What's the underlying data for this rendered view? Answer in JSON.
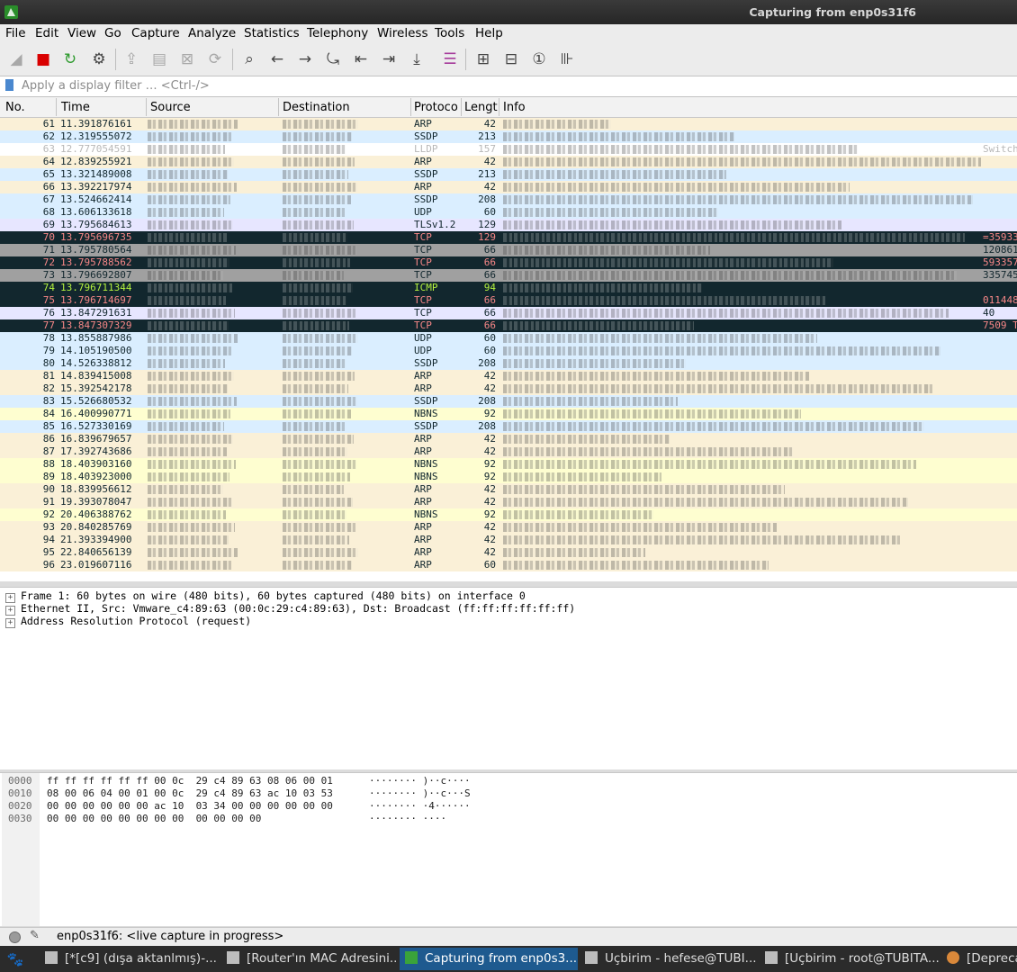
{
  "window": {
    "title": "Capturing from enp0s31f6"
  },
  "menu": [
    "File",
    "Edit",
    "View",
    "Go",
    "Capture",
    "Analyze",
    "Statistics",
    "Telephony",
    "Wireless",
    "Tools",
    "Help"
  ],
  "toolbar": {
    "buttons": [
      {
        "name": "shark-fin-start-icon",
        "glyph": "◢",
        "dim": true
      },
      {
        "name": "stop-capture-icon",
        "glyph": "■",
        "color": "#d90000"
      },
      {
        "name": "restart-capture-icon",
        "glyph": "↻",
        "color": "#2f9b2f"
      },
      {
        "name": "capture-options-icon",
        "glyph": "⚙"
      },
      {
        "name": "open-file-icon",
        "glyph": "⇪",
        "dim": true
      },
      {
        "name": "save-file-icon",
        "glyph": "▤",
        "dim": true
      },
      {
        "name": "close-file-icon",
        "glyph": "⊠",
        "dim": true
      },
      {
        "name": "reload-file-icon",
        "glyph": "⟳",
        "dim": true
      },
      {
        "name": "find-packet-icon",
        "glyph": "⌕"
      },
      {
        "name": "go-back-icon",
        "glyph": "←"
      },
      {
        "name": "go-forward-icon",
        "glyph": "→"
      },
      {
        "name": "go-to-packet-icon",
        "glyph": "⤿"
      },
      {
        "name": "first-packet-icon",
        "glyph": "⇤"
      },
      {
        "name": "last-packet-icon",
        "glyph": "⇥"
      },
      {
        "name": "autoscroll-icon",
        "glyph": "⤓"
      },
      {
        "name": "colorize-icon",
        "glyph": "☰",
        "color": "#a63c9b"
      },
      {
        "name": "zoom-in-icon",
        "glyph": "⊞"
      },
      {
        "name": "zoom-out-icon",
        "glyph": "⊟"
      },
      {
        "name": "normal-size-icon",
        "glyph": "①"
      },
      {
        "name": "resize-columns-icon",
        "glyph": "⊪"
      }
    ]
  },
  "filter": {
    "placeholder": "Apply a display filter … <Ctrl-/>"
  },
  "columns": [
    "No.",
    "Time",
    "Source",
    "Destination",
    "Protocol",
    "Length",
    "Info"
  ],
  "columns_display": [
    "No.",
    "Time",
    "Source",
    "Destination",
    "Protoco",
    "Lengt",
    "Info"
  ],
  "colors": {
    "arp": "#faf0d7",
    "udp": "#daeeff",
    "lldp": "#ffffff",
    "tls": "#e7e6ff",
    "tcp_bad": "#12272e",
    "tcp_bad_text": "#f78787",
    "tcp_grey": "#a0a0a0",
    "icmp_bad_text": "#b5f23e",
    "nbns": "#fefed0"
  },
  "packets": [
    {
      "no": "61",
      "time": "11.391876161",
      "proto": "ARP",
      "len": "42",
      "style": "arp"
    },
    {
      "no": "62",
      "time": "12.319555072",
      "proto": "SSDP",
      "len": "213",
      "style": "udp"
    },
    {
      "no": "63",
      "time": "12.777054591",
      "proto": "LLDP",
      "len": "157",
      "style": "lldp",
      "tail": "Switch"
    },
    {
      "no": "64",
      "time": "12.839255921",
      "proto": "ARP",
      "len": "42",
      "style": "arp"
    },
    {
      "no": "65",
      "time": "13.321489008",
      "proto": "SSDP",
      "len": "213",
      "style": "udp"
    },
    {
      "no": "66",
      "time": "13.392217974",
      "proto": "ARP",
      "len": "42",
      "style": "arp"
    },
    {
      "no": "67",
      "time": "13.524662414",
      "proto": "SSDP",
      "len": "208",
      "style": "udp"
    },
    {
      "no": "68",
      "time": "13.606133618",
      "proto": "UDP",
      "len": "60",
      "style": "udp"
    },
    {
      "no": "69",
      "time": "13.795684613",
      "proto": "TLSv1.2",
      "len": "129",
      "style": "tls"
    },
    {
      "no": "70",
      "time": "13.795696735",
      "proto": "TCP",
      "len": "129",
      "style": "dark",
      "tail": "=35933"
    },
    {
      "no": "71",
      "time": "13.795780564",
      "proto": "TCP",
      "len": "66",
      "style": "grey",
      "tail": "120861"
    },
    {
      "no": "72",
      "time": "13.795788562",
      "proto": "TCP",
      "len": "66",
      "style": "dark",
      "tail": "593357"
    },
    {
      "no": "73",
      "time": "13.796692807",
      "proto": "TCP",
      "len": "66",
      "style": "grey",
      "tail": "335745"
    },
    {
      "no": "74",
      "time": "13.796711344",
      "proto": "ICMP",
      "len": "94",
      "style": "darkicmp"
    },
    {
      "no": "75",
      "time": "13.796714697",
      "proto": "TCP",
      "len": "66",
      "style": "dark",
      "tail": "011448"
    },
    {
      "no": "76",
      "time": "13.847291631",
      "proto": "TCP",
      "len": "66",
      "style": "tls",
      "tail": "40"
    },
    {
      "no": "77",
      "time": "13.847307329",
      "proto": "TCP",
      "len": "66",
      "style": "dark",
      "tail": "7509 T"
    },
    {
      "no": "78",
      "time": "13.855887986",
      "proto": "UDP",
      "len": "60",
      "style": "udp"
    },
    {
      "no": "79",
      "time": "14.105190500",
      "proto": "UDP",
      "len": "60",
      "style": "udp"
    },
    {
      "no": "80",
      "time": "14.526338812",
      "proto": "SSDP",
      "len": "208",
      "style": "udp"
    },
    {
      "no": "81",
      "time": "14.839415008",
      "proto": "ARP",
      "len": "42",
      "style": "arp"
    },
    {
      "no": "82",
      "time": "15.392542178",
      "proto": "ARP",
      "len": "42",
      "style": "arp"
    },
    {
      "no": "83",
      "time": "15.526680532",
      "proto": "SSDP",
      "len": "208",
      "style": "udp"
    },
    {
      "no": "84",
      "time": "16.400990771",
      "proto": "NBNS",
      "len": "92",
      "style": "nbns"
    },
    {
      "no": "85",
      "time": "16.527330169",
      "proto": "SSDP",
      "len": "208",
      "style": "udp"
    },
    {
      "no": "86",
      "time": "16.839679657",
      "proto": "ARP",
      "len": "42",
      "style": "arp"
    },
    {
      "no": "87",
      "time": "17.392743686",
      "proto": "ARP",
      "len": "42",
      "style": "arp"
    },
    {
      "no": "88",
      "time": "18.403903160",
      "proto": "NBNS",
      "len": "92",
      "style": "nbns"
    },
    {
      "no": "89",
      "time": "18.403923000",
      "proto": "NBNS",
      "len": "92",
      "style": "nbns"
    },
    {
      "no": "90",
      "time": "18.839956612",
      "proto": "ARP",
      "len": "42",
      "style": "arp"
    },
    {
      "no": "91",
      "time": "19.393078047",
      "proto": "ARP",
      "len": "42",
      "style": "arp"
    },
    {
      "no": "92",
      "time": "20.406388762",
      "proto": "NBNS",
      "len": "92",
      "style": "nbns"
    },
    {
      "no": "93",
      "time": "20.840285769",
      "proto": "ARP",
      "len": "42",
      "style": "arp"
    },
    {
      "no": "94",
      "time": "21.393394900",
      "proto": "ARP",
      "len": "42",
      "style": "arp"
    },
    {
      "no": "95",
      "time": "22.840656139",
      "proto": "ARP",
      "len": "42",
      "style": "arp"
    },
    {
      "no": "96",
      "time": "23.019607116",
      "proto": "ARP",
      "len": "60",
      "style": "arp"
    }
  ],
  "details": [
    "Frame 1: 60 bytes on wire (480 bits), 60 bytes captured (480 bits) on interface 0",
    "Ethernet II, Src: Vmware_c4:89:63 (00:0c:29:c4:89:63), Dst: Broadcast (ff:ff:ff:ff:ff:ff)",
    "Address Resolution Protocol (request)"
  ],
  "bytes": [
    {
      "offset": "0000",
      "hex": "ff ff ff ff ff ff 00 0c  29 c4 89 63 08 06 00 01",
      "ascii": "········ )··c····"
    },
    {
      "offset": "0010",
      "hex": "08 00 06 04 00 01 00 0c  29 c4 89 63 ac 10 03 53",
      "ascii": "········ )··c···S"
    },
    {
      "offset": "0020",
      "hex": "00 00 00 00 00 00 ac 10  03 34 00 00 00 00 00 00",
      "ascii": "········ ·4······"
    },
    {
      "offset": "0030",
      "hex": "00 00 00 00 00 00 00 00  00 00 00 00",
      "ascii": "········ ····"
    }
  ],
  "status": {
    "text": "enp0s31f6: <live capture in progress>"
  },
  "taskbar": [
    {
      "label": "[*[c9] (dışa aktanlmış)-...",
      "active": false
    },
    {
      "label": "[Router'ın MAC Adresini...",
      "active": false
    },
    {
      "label": "Capturing from enp0s3...",
      "active": true
    },
    {
      "label": "Uçbirim - hefese@TUBI...",
      "active": false
    },
    {
      "label": "[Uçbirim - root@TUBITA...",
      "active": false
    },
    {
      "label": "[Depreca",
      "active": false
    }
  ]
}
